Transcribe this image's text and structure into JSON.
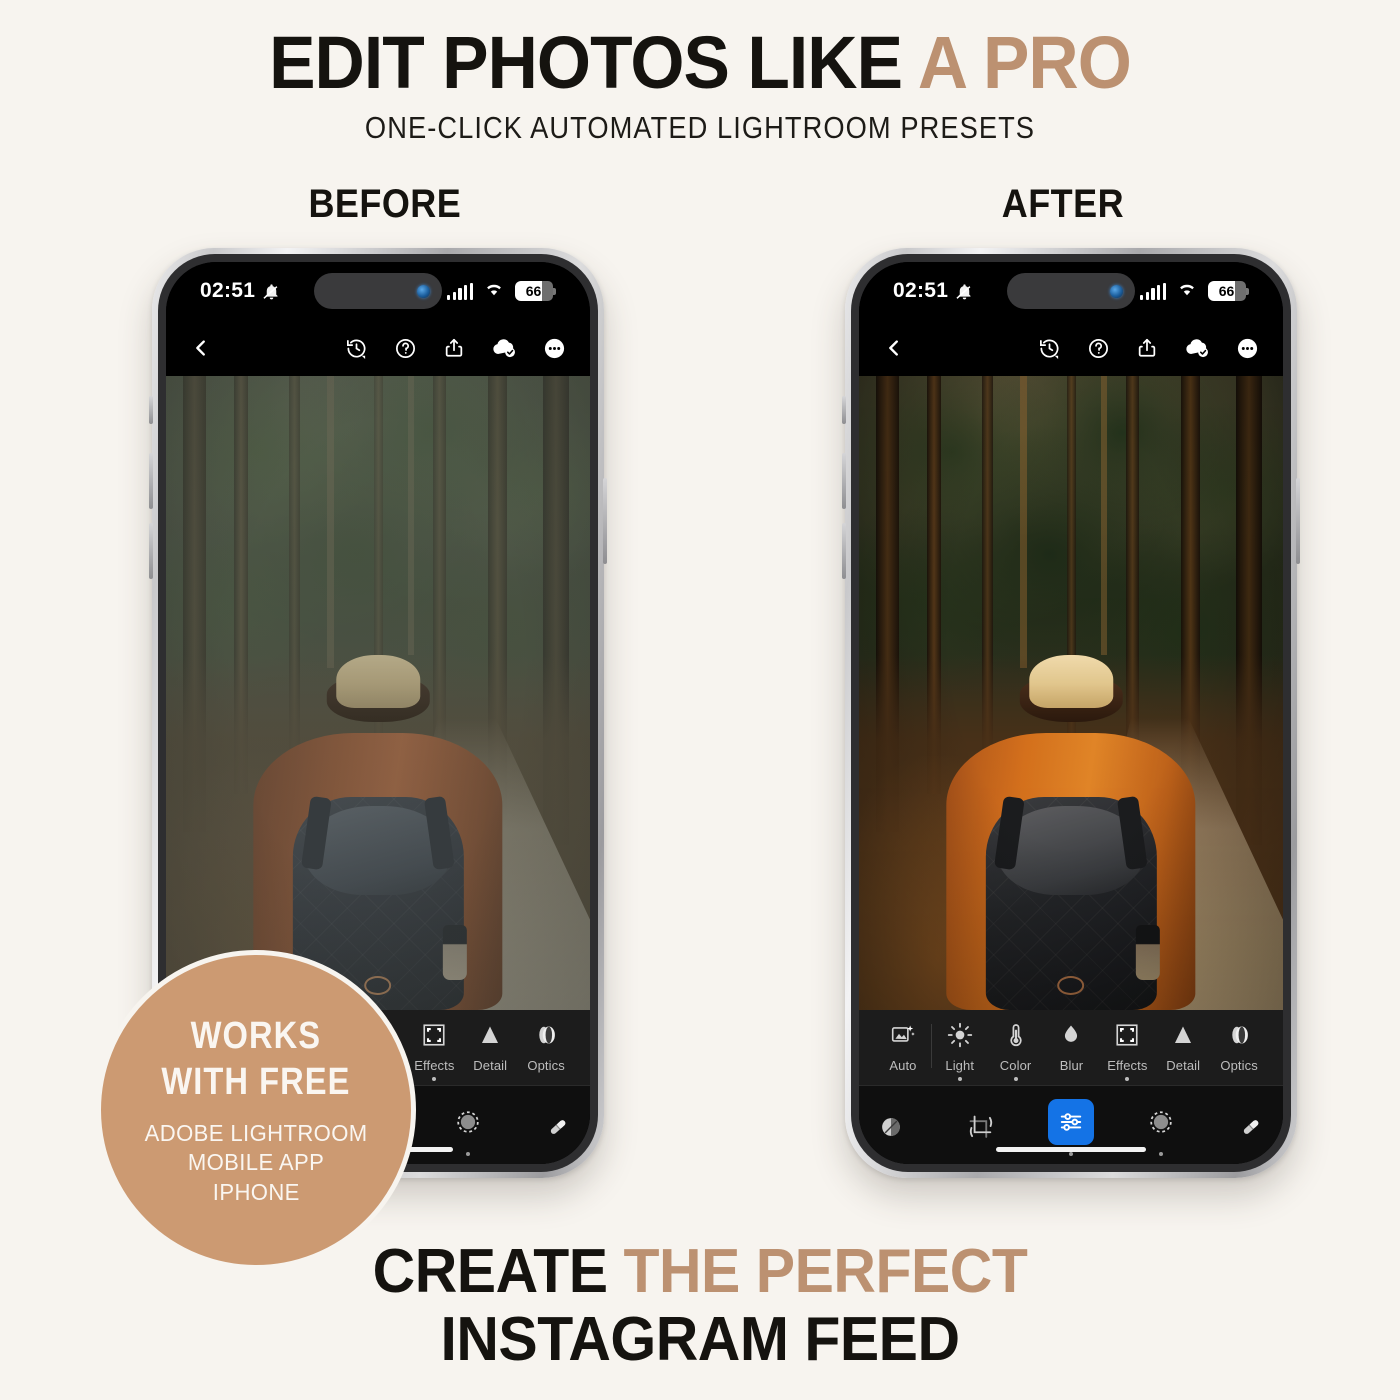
{
  "background_color": "#F7F4EF",
  "accent_color": "#BC9171",
  "badge_color": "#CC9A72",
  "header": {
    "title_dark": "EDIT PHOTOS LIKE ",
    "title_accent": "A PRO",
    "subtitle": "ONE-CLICK AUTOMATED LIGHTROOM PRESETS"
  },
  "compare": {
    "before_label": "BEFORE",
    "after_label": "AFTER"
  },
  "phone": {
    "status": {
      "time": "02:51",
      "mute_icon": "bell-slash-icon",
      "signal_icon": "cellular-bars-icon",
      "wifi_icon": "wifi-icon",
      "battery_level": "66",
      "battery_icon": "battery-icon",
      "island": "dynamic-island"
    },
    "app_toolbar": {
      "back_icon": "chevron-left-icon",
      "items": [
        {
          "icon": "history-versions-icon",
          "name": "versions"
        },
        {
          "icon": "question-circle-icon",
          "name": "help"
        },
        {
          "icon": "share-icon",
          "name": "share"
        },
        {
          "icon": "cloud-check-icon",
          "name": "cloud-sync"
        },
        {
          "icon": "more-ellipsis-icon",
          "name": "more"
        }
      ]
    },
    "edit_tools": [
      {
        "label": "Auto",
        "icon": "auto-magic-icon",
        "has_dot": false
      },
      {
        "label": "Light",
        "icon": "sun-icon",
        "has_dot": true
      },
      {
        "label": "Color",
        "icon": "thermometer-icon",
        "has_dot": true
      },
      {
        "label": "Blur",
        "icon": "droplet-icon",
        "has_dot": false
      },
      {
        "label": "Effects",
        "icon": "frame-brackets-icon",
        "has_dot": true
      },
      {
        "label": "Detail",
        "icon": "triangle-icon",
        "has_dot": false
      },
      {
        "label": "Optics",
        "icon": "lens-circles-icon",
        "has_dot": false
      }
    ],
    "bottom_tools": [
      {
        "name": "presets",
        "icon": "presets-icon",
        "active": false,
        "has_dot": false
      },
      {
        "name": "crop",
        "icon": "crop-rotate-icon",
        "active": false,
        "has_dot": false
      },
      {
        "name": "edit",
        "icon": "sliders-icon",
        "active": true,
        "has_dot": true
      },
      {
        "name": "masking",
        "icon": "mask-circle-icon",
        "active": false,
        "has_dot": true
      },
      {
        "name": "healing",
        "icon": "healing-brush-icon",
        "active": false,
        "has_dot": false
      }
    ],
    "home_indicator": "home-bar"
  },
  "badge": {
    "line1": "WORKS",
    "line2": "WITH FREE",
    "sub1": "ADOBE LIGHTROOM",
    "sub2": "MOBILE APP",
    "sub3": "IPHONE"
  },
  "footer": {
    "line1_dark": "CREATE ",
    "line1_accent": "THE PERFECT",
    "line2": "INSTAGRAM FEED"
  },
  "photo": {
    "subject": "hiker-in-forest",
    "before_style": "muted desaturated cool green",
    "after_style": "warm orange high contrast"
  }
}
